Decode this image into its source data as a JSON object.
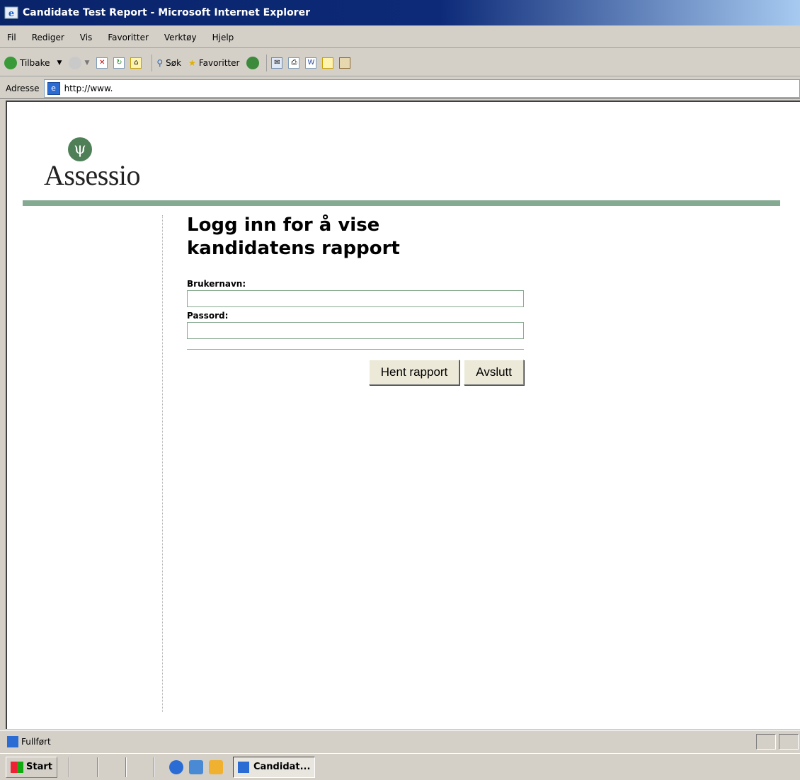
{
  "window": {
    "title": "Candidate Test Report - Microsoft Internet Explorer"
  },
  "menu": [
    "Fil",
    "Rediger",
    "Vis",
    "Favoritter",
    "Verktøy",
    "Hjelp"
  ],
  "toolbar": {
    "back_label": "Tilbake",
    "search_label": "Søk",
    "favorites_label": "Favoritter"
  },
  "address": {
    "label": "Adresse",
    "url": "http://www."
  },
  "page": {
    "logo_text": "Assessio",
    "logo_symbol": "ψ",
    "heading_line1": "Logg inn for å vise",
    "heading_line2": "kandidatens rapport",
    "username_label": "Brukernavn:",
    "password_label": "Passord:",
    "get_report_label": "Hent rapport",
    "exit_label": "Avslutt"
  },
  "status": {
    "text": "Fullført"
  },
  "taskbar": {
    "start_label": "Start",
    "task_label": "Candidat..."
  },
  "colors": {
    "title_bar": "#0a246a",
    "accent_green": "#84ab92",
    "logo_green": "#4e7f56"
  }
}
